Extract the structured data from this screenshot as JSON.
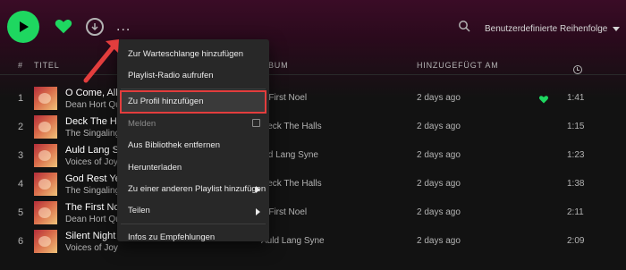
{
  "colors": {
    "accent": "#1ed760",
    "highlight_outline": "#e33d3d",
    "arrow": "#e33d3d"
  },
  "toolbar": {
    "play_icon": "play-icon",
    "heart_icon": "heart-icon",
    "download_icon": "download-icon",
    "more_label": "...",
    "search_icon": "search-icon",
    "sort_label": "Benutzerdefinierte Reihenfolge"
  },
  "columns": {
    "num": "#",
    "title": "TITEL",
    "album": "BUM",
    "added": "HINZUGEFÜGT AM",
    "duration_icon": "clock-icon"
  },
  "tracks": [
    {
      "num": "1",
      "title": "O Come, All T",
      "artist": "Dean Hort Qua",
      "album": "e First Noel",
      "added": "2 days ago",
      "liked": true,
      "duration": "1:41"
    },
    {
      "num": "2",
      "title": "Deck The Ha",
      "artist": "The Singalings",
      "album": "Deck The Halls",
      "added": "2 days ago",
      "liked": false,
      "duration": "1:15"
    },
    {
      "num": "3",
      "title": "Auld Lang Sy",
      "artist": "Voices of Joy",
      "album": "uld Lang Syne",
      "added": "2 days ago",
      "liked": false,
      "duration": "1:23"
    },
    {
      "num": "4",
      "title": "God Rest Ye",
      "artist": "The Singalings",
      "album": "Deck The Halls",
      "added": "2 days ago",
      "liked": false,
      "duration": "1:38"
    },
    {
      "num": "5",
      "title": "The First Noe",
      "artist": "Dean Hort Qua",
      "album": "e First Noel",
      "added": "2 days ago",
      "liked": false,
      "duration": "2:11"
    },
    {
      "num": "6",
      "title": "Silent Night",
      "artist": "Voices of Joy",
      "album": "Auld Lang Syne",
      "added": "2 days ago",
      "liked": false,
      "duration": "2:09"
    }
  ],
  "menu": {
    "items": [
      {
        "label": "Zur Warteschlange hinzufügen"
      },
      {
        "label": "Playlist-Radio aufrufen"
      },
      {
        "label": "Zu Profil hinzufügen",
        "highlighted": true
      },
      {
        "label": "Melden",
        "disabled": true,
        "external": true
      },
      {
        "label": "Aus Bibliothek entfernen"
      },
      {
        "label": "Herunterladen"
      },
      {
        "label": "Zu einer anderen Playlist hinzufügen",
        "submenu": true
      },
      {
        "label": "Teilen",
        "submenu": true
      },
      {
        "label": "Infos zu Empfehlungen"
      }
    ]
  }
}
